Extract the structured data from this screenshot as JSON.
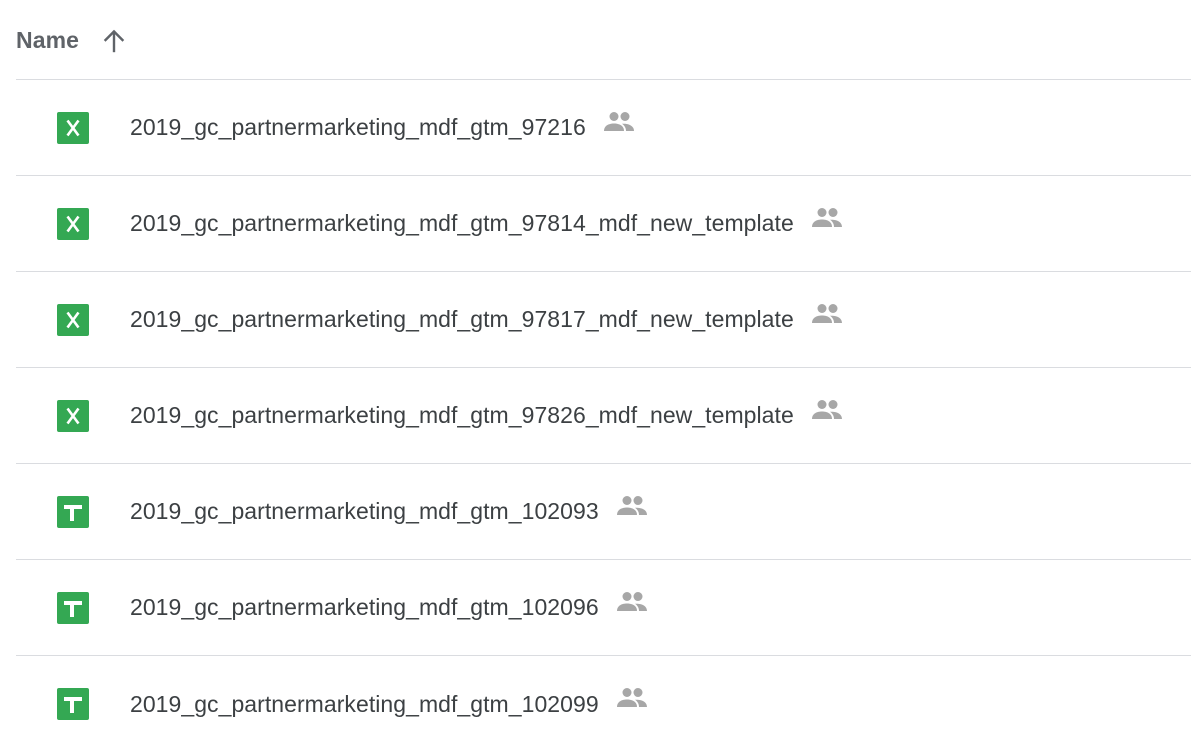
{
  "header": {
    "name_label": "Name",
    "sort_icon": "arrow-up-icon"
  },
  "files": [
    {
      "name": "2019_gc_partnermarketing_mdf_gtm_97216",
      "type": "excel",
      "icon": "excel-file-icon",
      "shared": true
    },
    {
      "name": "2019_gc_partnermarketing_mdf_gtm_97814_mdf_new_template",
      "type": "excel",
      "icon": "excel-file-icon",
      "shared": true
    },
    {
      "name": "2019_gc_partnermarketing_mdf_gtm_97817_mdf_new_template",
      "type": "excel",
      "icon": "excel-file-icon",
      "shared": true
    },
    {
      "name": "2019_gc_partnermarketing_mdf_gtm_97826_mdf_new_template",
      "type": "excel",
      "icon": "excel-file-icon",
      "shared": true
    },
    {
      "name": "2019_gc_partnermarketing_mdf_gtm_102093",
      "type": "sheets",
      "icon": "sheets-file-icon",
      "shared": true
    },
    {
      "name": "2019_gc_partnermarketing_mdf_gtm_102096",
      "type": "sheets",
      "icon": "sheets-file-icon",
      "shared": true
    },
    {
      "name": "2019_gc_partnermarketing_mdf_gtm_102099",
      "type": "sheets",
      "icon": "sheets-file-icon",
      "shared": true
    }
  ],
  "colors": {
    "icon_green": "#34a853",
    "shared_icon": "#a7a7a7",
    "text": "#3c4043",
    "header_text": "#5f6368",
    "divider": "#dadce0"
  }
}
